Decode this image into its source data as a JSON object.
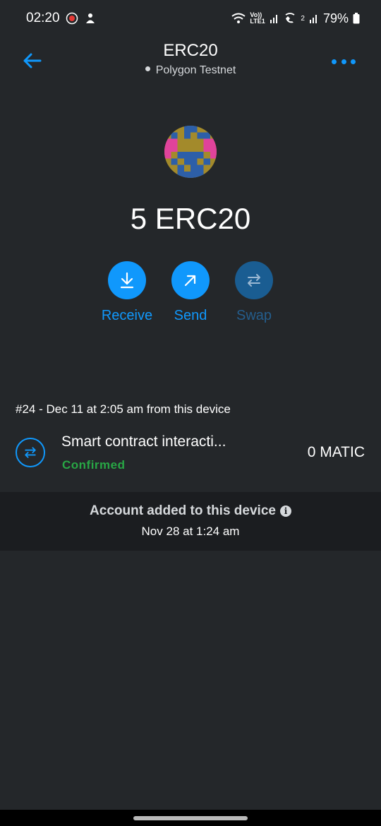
{
  "status_bar": {
    "time": "02:20",
    "network_label": "Vo)) LTE1",
    "sim2_label": "2",
    "battery": "79%"
  },
  "header": {
    "title": "ERC20",
    "network": "Polygon Testnet"
  },
  "token": {
    "balance": "5 ERC20"
  },
  "actions": [
    {
      "label": "Receive",
      "icon": "download-arrow-icon",
      "enabled": true
    },
    {
      "label": "Send",
      "icon": "arrow-up-right-icon",
      "enabled": true
    },
    {
      "label": "Swap",
      "icon": "swap-icon",
      "enabled": false
    }
  ],
  "transaction": {
    "date_line": "#24 - Dec 11 at 2:05 am from this device",
    "title": "Smart contract interacti...",
    "status": "Confirmed",
    "amount": "0 MATIC",
    "icon": "swap-icon"
  },
  "account_notice": {
    "title": "Account added to this device",
    "date": "Nov 28 at 1:24 am"
  },
  "colors": {
    "background": "#24272a",
    "accent": "#1098fc",
    "success": "#28a745",
    "banner": "#1b1d20"
  }
}
